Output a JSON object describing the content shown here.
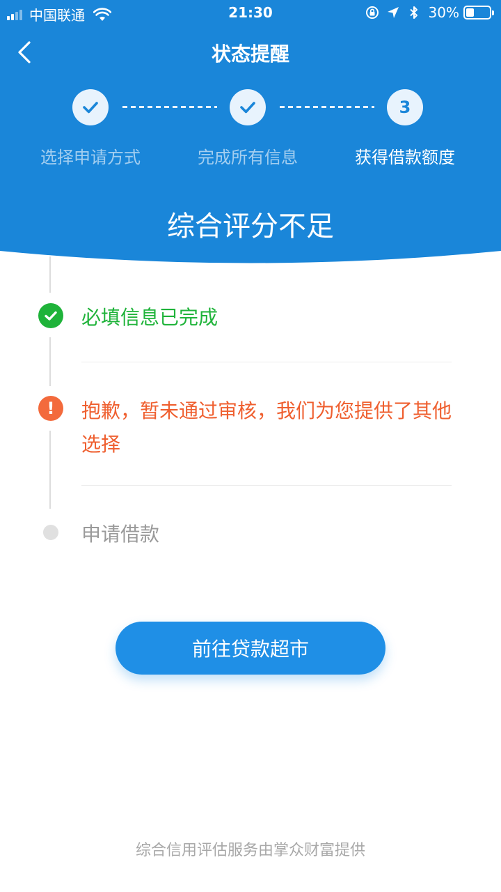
{
  "status_bar": {
    "carrier": "中国联通",
    "time": "21:30",
    "battery": "30%"
  },
  "nav": {
    "title": "状态提醒"
  },
  "steps": [
    {
      "label": "选择申请方式",
      "state": "done"
    },
    {
      "label": "完成所有信息",
      "state": "done"
    },
    {
      "label": "获得借款额度",
      "state": "current",
      "number": "3"
    }
  ],
  "hero": {
    "title": "综合评分不足"
  },
  "timeline": [
    {
      "text": "必填信息已完成",
      "state": "ok"
    },
    {
      "text": "抱歉，暂未通过审核，我们为您提供了其他选择",
      "state": "warn",
      "icon": "!"
    },
    {
      "text": "申请借款",
      "state": "pending"
    }
  ],
  "cta": {
    "label": "前往贷款超市"
  },
  "footer": {
    "text": "综合信用评估服务由掌众财富提供"
  },
  "colors": {
    "header_blue": "#1a86d9",
    "success": "#1fb33a",
    "warning": "#ef5f2f",
    "button": "#1f8fe6"
  }
}
